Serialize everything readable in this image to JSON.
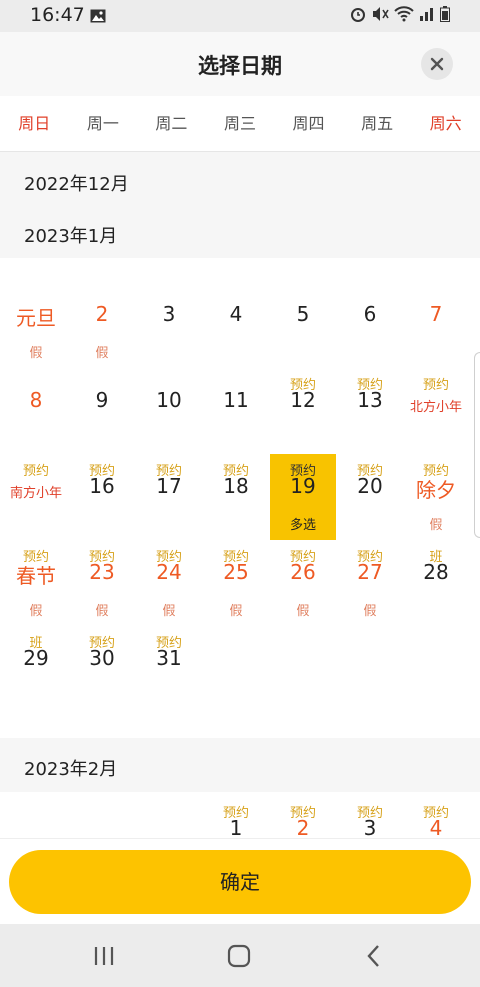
{
  "status_bar": {
    "time": "16:47"
  },
  "header": {
    "title": "选择日期"
  },
  "weekdays": [
    "周日",
    "周一",
    "周二",
    "周三",
    "周四",
    "周五",
    "周六"
  ],
  "months": {
    "dec": "2022年12月",
    "jan": "2023年1月",
    "feb": "2023年2月"
  },
  "jan_days": [
    {
      "col": 0,
      "row": 0,
      "day": "元旦",
      "foot": "假"
    },
    {
      "col": 1,
      "row": 0,
      "day": "2",
      "foot": "假"
    },
    {
      "col": 2,
      "row": 0,
      "day": "3"
    },
    {
      "col": 3,
      "row": 0,
      "day": "4"
    },
    {
      "col": 4,
      "row": 0,
      "day": "5"
    },
    {
      "col": 5,
      "row": 0,
      "day": "6"
    },
    {
      "col": 6,
      "row": 0,
      "day": "7"
    },
    {
      "col": 0,
      "row": 1,
      "day": "8"
    },
    {
      "col": 1,
      "row": 1,
      "day": "9"
    },
    {
      "col": 2,
      "row": 1,
      "day": "10"
    },
    {
      "col": 3,
      "row": 1,
      "day": "11"
    },
    {
      "col": 4,
      "row": 1,
      "day": "12",
      "tag": "预约"
    },
    {
      "col": 5,
      "row": 1,
      "day": "13",
      "tag": "预约"
    },
    {
      "col": 6,
      "row": 1,
      "tag": "预约",
      "sub": "北方小年"
    },
    {
      "col": 0,
      "row": 2,
      "tag": "预约",
      "sub": "南方小年"
    },
    {
      "col": 1,
      "row": 2,
      "day": "16",
      "tag": "预约"
    },
    {
      "col": 2,
      "row": 2,
      "day": "17",
      "tag": "预约"
    },
    {
      "col": 3,
      "row": 2,
      "day": "18",
      "tag": "预约"
    },
    {
      "col": 4,
      "row": 2,
      "day": "19",
      "tag": "预约",
      "foot": "多选"
    },
    {
      "col": 5,
      "row": 2,
      "day": "20",
      "tag": "预约"
    },
    {
      "col": 6,
      "row": 2,
      "day": "除夕",
      "tag": "预约",
      "foot": "假"
    },
    {
      "col": 0,
      "row": 3,
      "day": "春节",
      "tag": "预约",
      "foot": "假"
    },
    {
      "col": 1,
      "row": 3,
      "day": "23",
      "tag": "预约",
      "foot": "假"
    },
    {
      "col": 2,
      "row": 3,
      "day": "24",
      "tag": "预约",
      "foot": "假"
    },
    {
      "col": 3,
      "row": 3,
      "day": "25",
      "tag": "预约",
      "foot": "假"
    },
    {
      "col": 4,
      "row": 3,
      "day": "26",
      "tag": "预约",
      "foot": "假"
    },
    {
      "col": 5,
      "row": 3,
      "day": "27",
      "tag": "预约",
      "foot": "假"
    },
    {
      "col": 6,
      "row": 3,
      "day": "28",
      "tag": "班"
    },
    {
      "col": 0,
      "row": 4,
      "day": "29",
      "tag": "班"
    },
    {
      "col": 1,
      "row": 4,
      "day": "30",
      "tag": "预约"
    },
    {
      "col": 2,
      "row": 4,
      "day": "31",
      "tag": "预约"
    }
  ],
  "feb_days": [
    {
      "col": 3,
      "day": "1",
      "tag": "预约"
    },
    {
      "col": 4,
      "day": "2",
      "tag": "预约"
    },
    {
      "col": 5,
      "day": "3",
      "tag": "预约"
    },
    {
      "col": 6,
      "day": "4",
      "tag": "预约"
    }
  ],
  "footer": {
    "confirm_label": "确定"
  }
}
